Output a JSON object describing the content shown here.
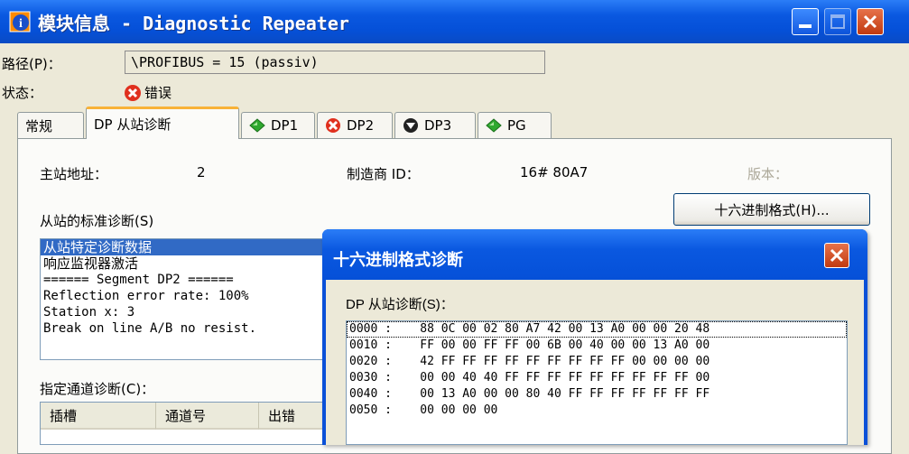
{
  "window": {
    "title": "模块信息 - Diagnostic Repeater"
  },
  "path": {
    "label": "路径(P)：",
    "value": "\\PROFIBUS = 15 (passiv)"
  },
  "status": {
    "label": "状态：",
    "value": "错误",
    "icon": "error-x-icon",
    "color": "#e0301e"
  },
  "tabs": [
    {
      "label": "常规",
      "icon": ""
    },
    {
      "label": "DP 从站诊断",
      "icon": ""
    },
    {
      "label": "DP1",
      "icon": "green-diamond-icon"
    },
    {
      "label": "DP2",
      "icon": "error-x-icon"
    },
    {
      "label": "DP3",
      "icon": "down-arrow-circle-icon"
    },
    {
      "label": "PG",
      "icon": "green-diamond-icon"
    }
  ],
  "info": {
    "master_label": "主站地址：",
    "master_value": "2",
    "vendor_label": "制造商 ID：",
    "vendor_value": "16# 80A7",
    "version_label": "版本："
  },
  "hex_button": {
    "label": "十六进制格式(H)..."
  },
  "std_diag": {
    "label": "从站的标准诊断(S)",
    "items": [
      "从站特定诊断数据",
      "响应监视器激活",
      "====== Segment DP2 ======",
      "Reflection error rate: 100%",
      "Station x: 3",
      "Break on line A/B no resist."
    ]
  },
  "channel_diag": {
    "label": "指定通道诊断(C)：",
    "columns": [
      "插槽",
      "通道号",
      "出错"
    ]
  },
  "hex_dialog": {
    "title": "十六进制格式诊断",
    "subtitle": "DP 从站诊断(S)：",
    "rows": [
      "0000 :    88 0C 00 02 80 A7 42 00 13 A0 00 00 20 48",
      "0010 :    FF 00 00 FF FF 00 6B 00 40 00 00 13 A0 00",
      "0020 :    42 FF FF FF FF FF FF FF FF FF 00 00 00 00",
      "0030 :    00 00 40 40 FF FF FF FF FF FF FF FF FF 00",
      "0040 :    00 13 A0 00 00 80 40 FF FF FF FF FF FF FF",
      "0050 :    00 00 00 00"
    ]
  },
  "colors": {
    "titlebar": "#0a58e0",
    "selection": "#316ac5",
    "close": "#c13a10",
    "tab_accent": "#f8b238",
    "ok_green": "#2fa82f"
  }
}
